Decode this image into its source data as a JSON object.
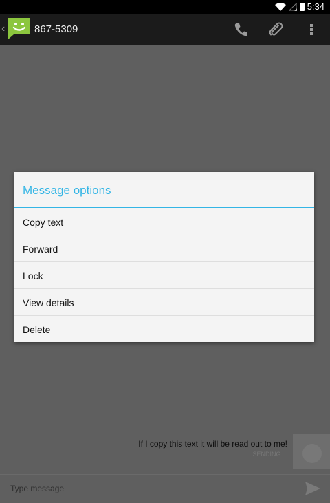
{
  "status_bar": {
    "time": "5:34",
    "icons": [
      "wifi-icon",
      "signal-icon",
      "battery-icon"
    ]
  },
  "action_bar": {
    "title": "867-5309",
    "back_glyph": "‹",
    "actions": [
      {
        "name": "call",
        "icon": "phone-icon"
      },
      {
        "name": "attach",
        "icon": "paperclip-icon"
      },
      {
        "name": "more",
        "icon": "overflow-menu-icon"
      }
    ]
  },
  "dialog": {
    "title": "Message options",
    "items": [
      {
        "label": "Copy text"
      },
      {
        "label": "Forward"
      },
      {
        "label": "Lock"
      },
      {
        "label": "View details"
      },
      {
        "label": "Delete"
      }
    ]
  },
  "conversation": {
    "messages": [
      {
        "text": "If I copy this text it will be read out to me!",
        "status": "SENDING..."
      }
    ]
  },
  "composer": {
    "placeholder": "Type message",
    "send_icon": "send-icon"
  },
  "colors": {
    "accent": "#33b5e5",
    "sms_green": "#8cc63e",
    "action_bar": "#1b1b1b",
    "dim_background": "#5f5f5f"
  }
}
